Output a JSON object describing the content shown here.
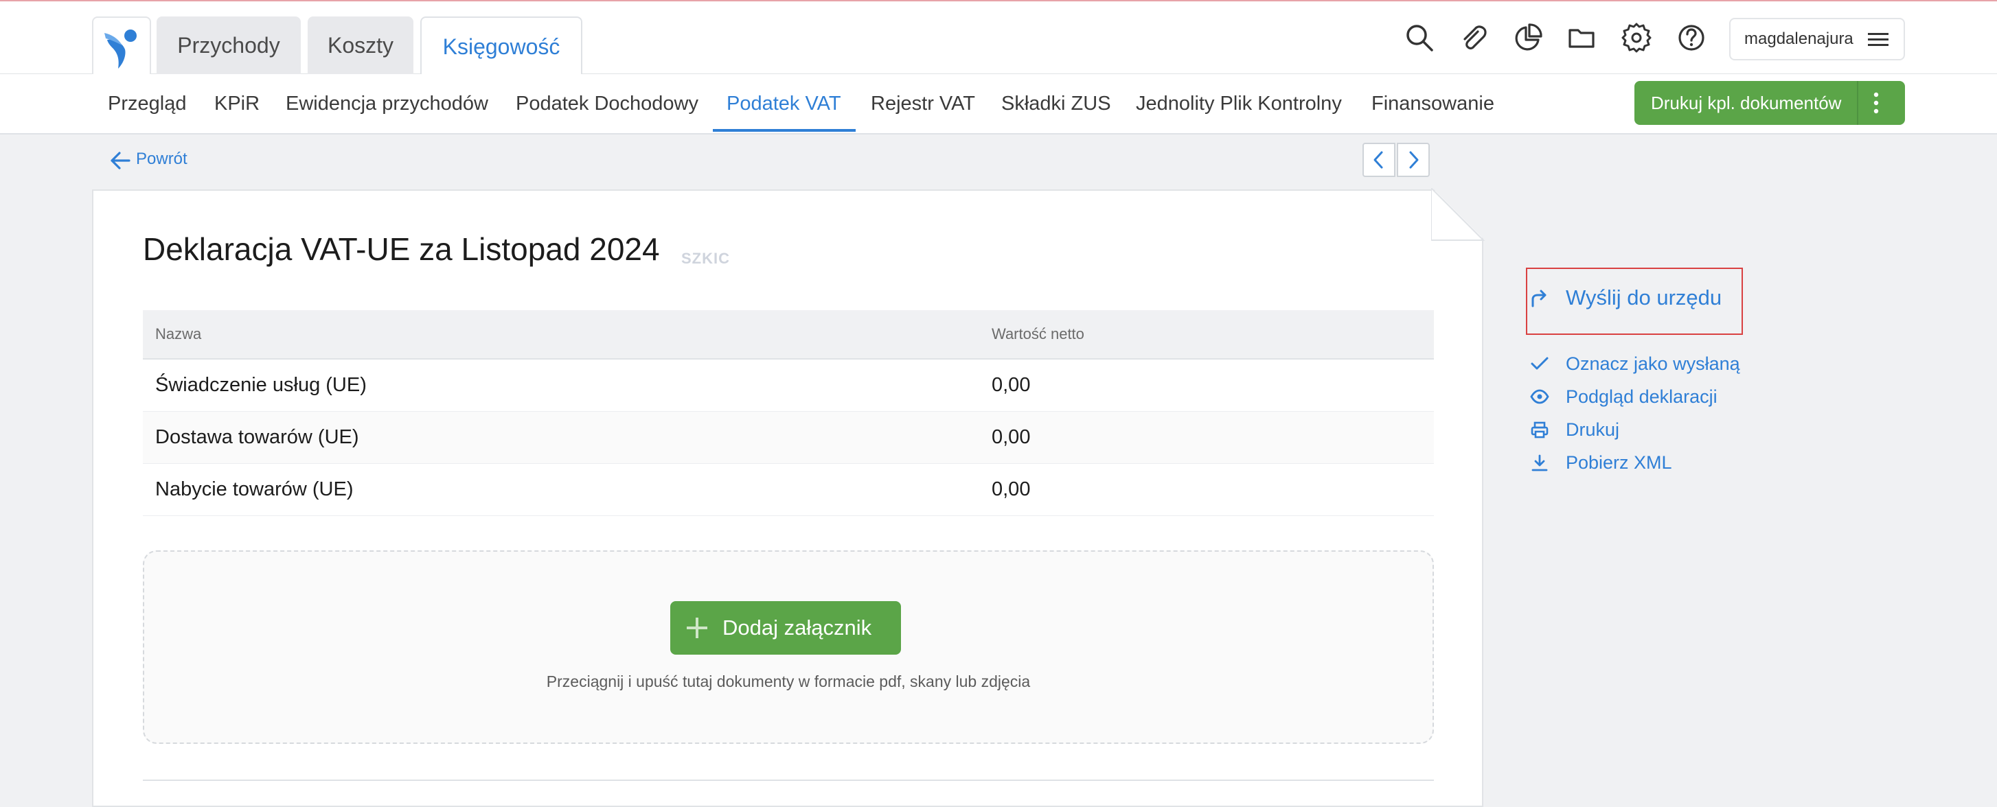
{
  "topbar": {
    "tabs": [
      {
        "label": "Przychody"
      },
      {
        "label": "Koszty"
      },
      {
        "label": "Księgowość"
      }
    ],
    "username": "magdalenajura",
    "icons": [
      "search-icon",
      "paperclip-icon",
      "pie-chart-icon",
      "folder-icon",
      "gear-icon",
      "help-icon",
      "menu-icon"
    ]
  },
  "subnav": {
    "items": [
      {
        "label": "Przegląd"
      },
      {
        "label": "KPiR"
      },
      {
        "label": "Ewidencja przychodów"
      },
      {
        "label": "Podatek Dochodowy"
      },
      {
        "label": "Podatek VAT"
      },
      {
        "label": "Rejestr VAT"
      },
      {
        "label": "Składki ZUS"
      },
      {
        "label": "Jednolity Plik Kontrolny"
      },
      {
        "label": "Finansowanie"
      }
    ],
    "active_index": 4,
    "print_button": "Drukuj kpl. dokumentów"
  },
  "back_label": "Powrót",
  "document": {
    "title": "Deklaracja VAT-UE za Listopad 2024",
    "status_badge": "SZKIC",
    "table": {
      "headers": [
        "Nazwa",
        "Wartość netto"
      ],
      "rows": [
        [
          "Świadczenie usług (UE)",
          "0,00"
        ],
        [
          "Dostawa towarów (UE)",
          "0,00"
        ],
        [
          "Nabycie towarów (UE)",
          "0,00"
        ]
      ]
    },
    "attachments": {
      "button": "Dodaj załącznik",
      "hint": "Przeciągnij i upuść tutaj dokumenty w formacie pdf, skany lub zdjęcia"
    }
  },
  "actions": {
    "send": "Wyślij do urzędu",
    "mark_sent": "Oznacz jako wysłaną",
    "preview": "Podgląd deklaracji",
    "print": "Drukuj",
    "download_xml": "Pobierz XML"
  },
  "colors": {
    "accent": "#2f7fd6",
    "green": "#5ba548",
    "highlight": "#d94141",
    "background": "#f0f1f3"
  }
}
